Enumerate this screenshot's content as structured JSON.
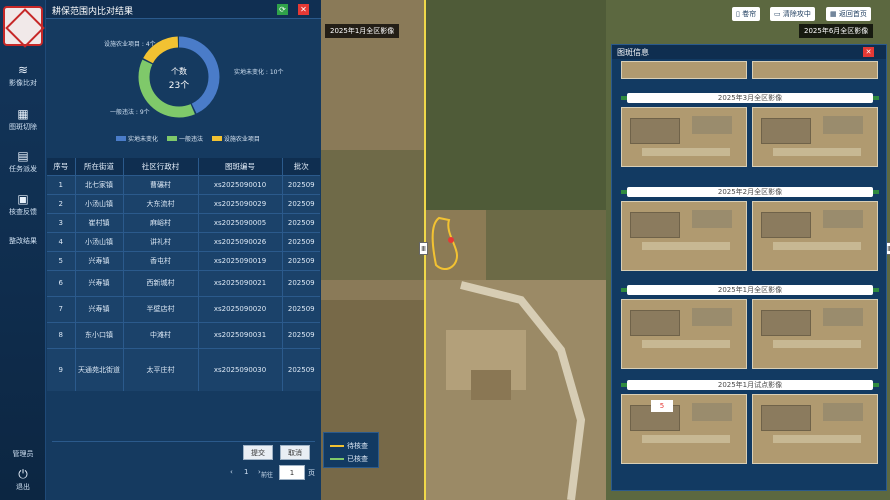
{
  "nav": {
    "logo_text": "",
    "items": [
      {
        "icon": "layers-icon",
        "label": "影像比对"
      },
      {
        "icon": "grid-icon",
        "label": "图斑切除"
      },
      {
        "icon": "clipboard-icon",
        "label": "任务派发"
      },
      {
        "icon": "review-icon",
        "label": "核查反馈"
      },
      {
        "icon": "result-icon",
        "label": "整改结果"
      }
    ],
    "admin_label": "管理员",
    "logout_label": "退出"
  },
  "panel": {
    "title": "耕保范围内比对结果",
    "donut": {
      "center_title": "个数",
      "center_value": "23个"
    },
    "table": {
      "headers": [
        "序号",
        "所在街道",
        "社区行政村",
        "图斑编号",
        "批次"
      ],
      "rows": [
        [
          "1",
          "北七家镇",
          "曹碾村",
          "xs2025090010",
          "202509"
        ],
        [
          "2",
          "小汤山镇",
          "大东流村",
          "xs2025090029",
          "202509"
        ],
        [
          "3",
          "崔村镇",
          "麻峪村",
          "xs2025090005",
          "202509"
        ],
        [
          "4",
          "小汤山镇",
          "讲礼村",
          "xs2025090026",
          "202509"
        ],
        [
          "5",
          "兴寿镇",
          "香屯村",
          "xs2025090019",
          "202509"
        ],
        [
          "6",
          "兴寿镇",
          "西新城村",
          "xs2025090021",
          "202509"
        ],
        [
          "7",
          "兴寿镇",
          "半壁店村",
          "xs2025090020",
          "202509"
        ],
        [
          "8",
          "东小口镇",
          "中滩村",
          "xs2025090031",
          "202509"
        ],
        [
          "9",
          "天通苑北街道",
          "太平庄村",
          "xs2025090030",
          "202509"
        ]
      ]
    },
    "submit_label": "提交",
    "cancel_label": "取消",
    "pager": {
      "prev": "‹",
      "page": "1",
      "next": "›",
      "goto_label": "前往",
      "input_value": "1",
      "suffix": "页"
    }
  },
  "chart_data": {
    "type": "pie",
    "categories": [
      "实地未变化",
      "一般违法",
      "设施农业项目"
    ],
    "values": [
      10,
      9,
      4
    ],
    "colors": [
      "#4a7cc9",
      "#7fc96a",
      "#f2c232"
    ],
    "slice_labels": [
      "实地未变化 : 10个",
      "一般违法 : 9个",
      "设施农业项目 : 4个"
    ],
    "legend": [
      "实地未变化",
      "一般违法",
      "设施农业项目"
    ],
    "legend_position": "bottom"
  },
  "map": {
    "left_label": "2025年1月全区影像",
    "right_label": "2025年6月全区影像",
    "handle_glyph": "Ⅲ",
    "top_buttons": [
      "卷帘",
      "清除攻中",
      "返回首页"
    ],
    "legend": [
      {
        "label": "待核查",
        "color": "#f2c232"
      },
      {
        "label": "已核查",
        "color": "#7fc96a"
      }
    ]
  },
  "image_info": {
    "title": "图斑信息",
    "groups": [
      "2025年3月全区影像",
      "2025年2月全区影像",
      "2025年1月全区影像",
      "2025年1月试点影像"
    ],
    "spinner_value": "5"
  }
}
